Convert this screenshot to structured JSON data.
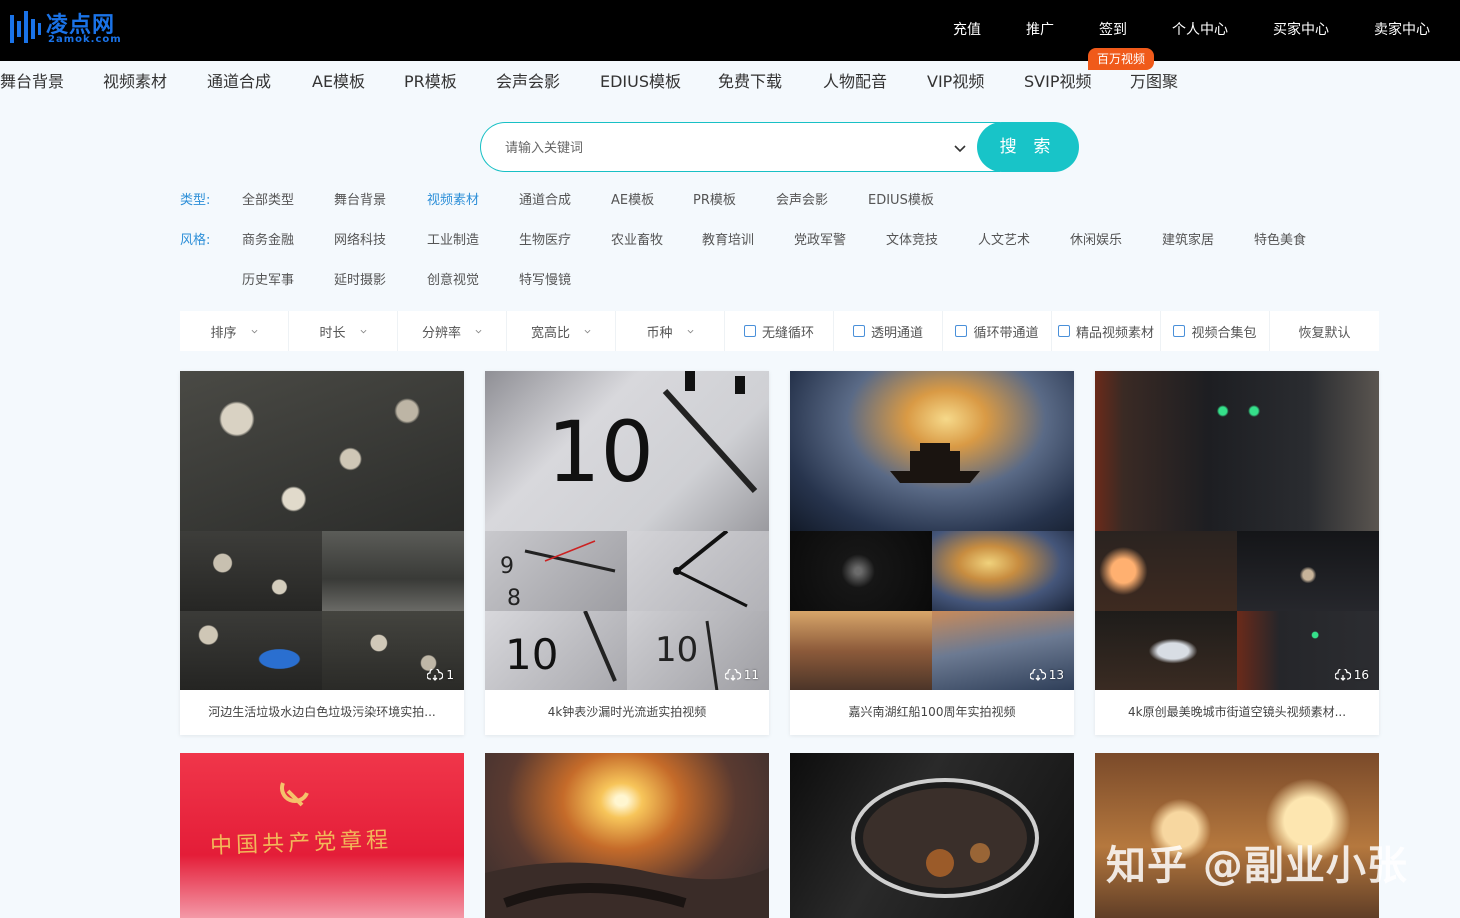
{
  "header": {
    "logo_name": "凌点网",
    "logo_sub": "2amok.com",
    "nav": [
      "充值",
      "推广",
      "签到",
      "个人中心",
      "买家中心",
      "卖家中心"
    ]
  },
  "categories": [
    "舞台背景",
    "视频素材",
    "通道合成",
    "AE模板",
    "PR模板",
    "会声会影",
    "EDIUS模板",
    "免费下载",
    "人物配音",
    "VIP视频",
    "SVIP视频",
    "万图聚"
  ],
  "hot_badge": "百万视频",
  "search": {
    "placeholder": "请输入关键词",
    "button": "搜 索"
  },
  "filters": {
    "type_label": "类型:",
    "types": [
      "全部类型",
      "舞台背景",
      "视频素材",
      "通道合成",
      "AE模板",
      "PR模板",
      "会声会影",
      "EDIUS模板"
    ],
    "active_type": "视频素材",
    "style_label": "风格:",
    "styles_row1": [
      "商务金融",
      "网络科技",
      "工业制造",
      "生物医疗",
      "农业畜牧",
      "教育培训",
      "党政军警",
      "文体竞技",
      "人文艺术",
      "休闲娱乐",
      "建筑家居",
      "特色美食"
    ],
    "styles_row2": [
      "历史军事",
      "延时摄影",
      "创意视觉",
      "特写慢镜"
    ]
  },
  "sortbar": {
    "dropdowns": [
      "排序",
      "时长",
      "分辨率",
      "宽高比",
      "币种"
    ],
    "checkboxes": [
      "无缝循环",
      "透明通道",
      "循环带通道",
      "精品视频素材",
      "视频合集包"
    ],
    "reset": "恢复默认"
  },
  "cards": [
    {
      "title": "河边生活垃圾水边白色垃圾污染环境实拍...",
      "count": "1"
    },
    {
      "title": "4k钟表沙漏时光流逝实拍视频",
      "count": "11"
    },
    {
      "title": "嘉兴南湖红船100周年实拍视频",
      "count": "13"
    },
    {
      "title": "4k原创最美晚城市街道空镜头视频素材...",
      "count": "16"
    }
  ],
  "card2_text": "中国共产党章程",
  "watermark": "知乎 @副业小张",
  "colors": {
    "accent": "#18c4c8",
    "link": "#2d8fd8",
    "badge": "#f05a1a"
  }
}
